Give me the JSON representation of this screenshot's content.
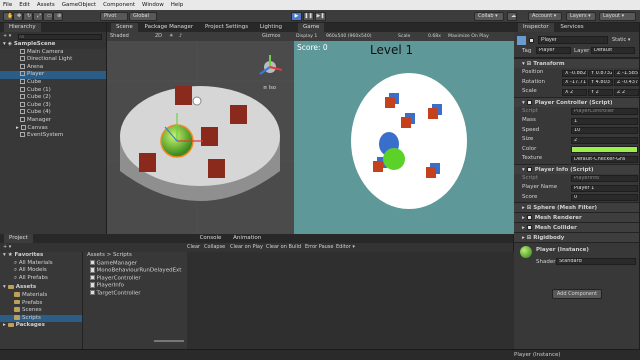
{
  "menu": [
    "File",
    "Edit",
    "Assets",
    "GameObject",
    "Component",
    "Window",
    "Help"
  ],
  "toolbar": {
    "pivot": "Pivot",
    "global": "Global",
    "collab": "Collab ▾",
    "account": "Account ▾",
    "layers": "Layers ▾",
    "layout": "Layout ▾"
  },
  "hierarchy": {
    "tab": "Hierarchy",
    "search_placeholder": "All",
    "scene": "SampleScene",
    "items": [
      "Main Camera",
      "Directional Light",
      "Arena",
      "Player",
      "Cube",
      "Cube (1)",
      "Cube (2)",
      "Cube (3)",
      "Cube (4)",
      "Manager",
      "Canvas",
      "EventSystem"
    ],
    "selected_index": 3
  },
  "scene_view": {
    "tabs": [
      "Scene",
      "Package Manager",
      "Project Settings",
      "Lighting"
    ],
    "shading": "Shaded",
    "mode": "2D",
    "gizmos": "Gizmos",
    "persp_label": "≡ Iso"
  },
  "game_view": {
    "tab": "Game",
    "display": "Display 1",
    "resolution": "960x540 (960x540)",
    "scale_label": "Scale",
    "scale_value": "0.68x",
    "maximize": "Maximize On Play",
    "mute": "Mute Audio",
    "stats": "Stats",
    "gizmos": "Gizmos",
    "score": "Score: 0",
    "level": "Level 1"
  },
  "inspector": {
    "tabs": [
      "Inspector",
      "Services"
    ],
    "object_name": "Player",
    "static_label": "Static ▾",
    "tag_label": "Tag",
    "tag": "Player",
    "layer_label": "Layer",
    "layer": "Default",
    "transform": {
      "title": "Transform",
      "position_label": "Position",
      "rotation_label": "Rotation",
      "scale_label": "Scale",
      "position": [
        "X -0.882",
        "Y 0.8732",
        "Z -1.585"
      ],
      "rotation": [
        "X -17.717",
        "Y 4.803",
        "Z -0.437"
      ],
      "scale": [
        "X 2",
        "Y 2",
        "Z 2"
      ]
    },
    "player_controller": {
      "title": "Player Controller (Script)",
      "script_label": "Script",
      "script": "PlayerController",
      "mass_label": "Mass",
      "mass": "1",
      "speed_label": "Speed",
      "speed": "10",
      "size_label": "Size",
      "size": "2",
      "color_label": "Color",
      "texture_label": "Texture",
      "texture": "Default-Checker-Gra"
    },
    "player_info": {
      "title": "Player Info (Script)",
      "script_label": "Script",
      "script": "PlayerInfo",
      "name_label": "Player Name",
      "name": "Player 1",
      "score_label": "Score",
      "score": "0"
    },
    "components": [
      "Sphere (Mesh Filter)",
      "Mesh Renderer",
      "Mesh Collider",
      "Rigidbody"
    ],
    "material": {
      "title": "Player (Instance)",
      "shader_label": "Shader",
      "shader": "Standard"
    },
    "add_component": "Add Component"
  },
  "project": {
    "tabs": [
      "Project",
      "Console",
      "Animation"
    ],
    "create": "+ ▾",
    "favorites": "Favorites",
    "fav_items": [
      "All Materials",
      "All Models",
      "All Prefabs"
    ],
    "assets": "Assets",
    "asset_folders": [
      "Materials",
      "Prefabs",
      "Scenes",
      "Scripts"
    ],
    "packages": "Packages",
    "breadcrumb": "Assets > Scripts",
    "scripts": [
      "GameManager",
      "MonoBehaviourRunDelayedExt",
      "PlayerController",
      "PlayerInfo",
      "TargetController"
    ]
  },
  "console": {
    "buttons": [
      "Clear",
      "Collapse",
      "Clear on Play",
      "Clear on Build",
      "Error Pause",
      "Editor ▾"
    ]
  },
  "status": "Player (Instance)",
  "colors": {
    "accent_blue": "#2c5d87",
    "player_color": "#9cf04a",
    "cube_red": "#8a2a1c",
    "game_bg": "#5f9898"
  }
}
